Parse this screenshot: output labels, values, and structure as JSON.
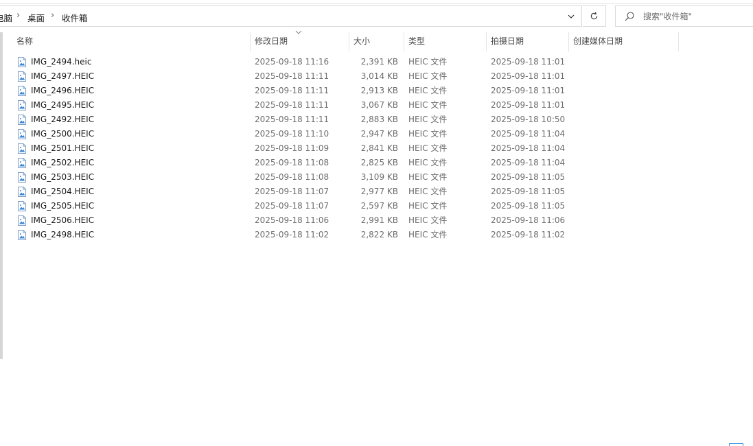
{
  "address_bar": {
    "breadcrumbs": [
      "电脑",
      "桌面",
      "收件箱"
    ],
    "separator": "›"
  },
  "search": {
    "placeholder": "搜索\"收件箱\""
  },
  "columns": [
    {
      "label": "名称"
    },
    {
      "label": "修改日期"
    },
    {
      "label": "大小"
    },
    {
      "label": "类型"
    },
    {
      "label": "拍摄日期"
    },
    {
      "label": "创建媒体日期"
    }
  ],
  "sorted_column": "修改日期",
  "files": [
    {
      "name": "IMG_2494.heic",
      "modified": "2025-09-18 11:16",
      "size": "2,391 KB",
      "type": "HEIC 文件",
      "taken": "2025-09-18 11:01"
    },
    {
      "name": "IMG_2497.HEIC",
      "modified": "2025-09-18 11:11",
      "size": "3,014 KB",
      "type": "HEIC 文件",
      "taken": "2025-09-18 11:01"
    },
    {
      "name": "IMG_2496.HEIC",
      "modified": "2025-09-18 11:11",
      "size": "2,913 KB",
      "type": "HEIC 文件",
      "taken": "2025-09-18 11:01"
    },
    {
      "name": "IMG_2495.HEIC",
      "modified": "2025-09-18 11:11",
      "size": "3,067 KB",
      "type": "HEIC 文件",
      "taken": "2025-09-18 11:01"
    },
    {
      "name": "IMG_2492.HEIC",
      "modified": "2025-09-18 11:11",
      "size": "2,883 KB",
      "type": "HEIC 文件",
      "taken": "2025-09-18 10:50"
    },
    {
      "name": "IMG_2500.HEIC",
      "modified": "2025-09-18 11:10",
      "size": "2,947 KB",
      "type": "HEIC 文件",
      "taken": "2025-09-18 11:04"
    },
    {
      "name": "IMG_2501.HEIC",
      "modified": "2025-09-18 11:09",
      "size": "2,841 KB",
      "type": "HEIC 文件",
      "taken": "2025-09-18 11:04"
    },
    {
      "name": "IMG_2502.HEIC",
      "modified": "2025-09-18 11:08",
      "size": "2,825 KB",
      "type": "HEIC 文件",
      "taken": "2025-09-18 11:04"
    },
    {
      "name": "IMG_2503.HEIC",
      "modified": "2025-09-18 11:08",
      "size": "3,109 KB",
      "type": "HEIC 文件",
      "taken": "2025-09-18 11:05"
    },
    {
      "name": "IMG_2504.HEIC",
      "modified": "2025-09-18 11:07",
      "size": "2,977 KB",
      "type": "HEIC 文件",
      "taken": "2025-09-18 11:05"
    },
    {
      "name": "IMG_2505.HEIC",
      "modified": "2025-09-18 11:07",
      "size": "2,597 KB",
      "type": "HEIC 文件",
      "taken": "2025-09-18 11:05"
    },
    {
      "name": "IMG_2506.HEIC",
      "modified": "2025-09-18 11:06",
      "size": "2,991 KB",
      "type": "HEIC 文件",
      "taken": "2025-09-18 11:06"
    },
    {
      "name": "IMG_2498.HEIC",
      "modified": "2025-09-18 11:02",
      "size": "2,822 KB",
      "type": "HEIC 文件",
      "taken": "2025-09-18 11:02"
    }
  ],
  "icons": {
    "dropdown": "chevron-down-icon",
    "refresh": "refresh-icon",
    "search": "search-icon",
    "file": "image-file-icon"
  }
}
